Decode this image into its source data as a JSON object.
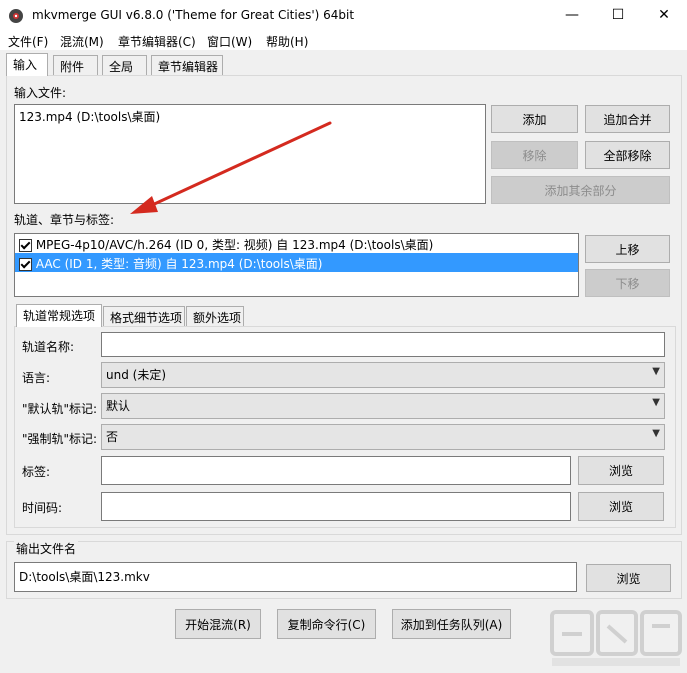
{
  "window": {
    "title": "mkvmerge GUI v6.8.0 ('Theme for Great Cities') 64bit",
    "controls": {
      "minimize": "—",
      "maximize": "☐",
      "close": "✕"
    }
  },
  "menu": [
    "文件(F)",
    "混流(M)",
    "章节编辑器(C)",
    "窗口(W)",
    "帮助(H)"
  ],
  "tabs": [
    "输入",
    "附件",
    "全局",
    "章节编辑器"
  ],
  "input": {
    "files_label": "输入文件:",
    "files": [
      "123.mp4 (D:\\tools\\桌面)"
    ],
    "buttons": {
      "add": "添加",
      "append": "追加合并",
      "remove": "移除",
      "remove_all": "全部移除",
      "add_other": "添加其余部分"
    },
    "tracks_label": "轨道、章节与标签:",
    "tracks": [
      {
        "text": "MPEG-4p10/AVC/h.264 (ID 0, 类型: 视频) 自 123.mp4 (D:\\tools\\桌面)",
        "checked": true,
        "selected": false
      },
      {
        "text": "AAC (ID 1, 类型: 音频) 自 123.mp4 (D:\\tools\\桌面)",
        "checked": true,
        "selected": true
      }
    ],
    "move_up": "上移",
    "move_down": "下移"
  },
  "subtabs": [
    "轨道常规选项",
    "格式细节选项",
    "额外选项"
  ],
  "options": {
    "track_name_label": "轨道名称:",
    "track_name_value": "",
    "language_label": "语言:",
    "language_value": "und (未定)",
    "default_flag_label": "\"默认轨\"标记:",
    "default_flag_value": "默认",
    "forced_flag_label": "\"强制轨\"标记:",
    "forced_flag_value": "否",
    "tags_label": "标签:",
    "tags_value": "",
    "timecodes_label": "时间码:",
    "timecodes_value": "",
    "browse": "浏览"
  },
  "output": {
    "label": "输出文件名",
    "value": "D:\\tools\\桌面\\123.mkv",
    "browse": "浏览"
  },
  "actions": {
    "start": "开始混流(R)",
    "copy_cmd": "复制命令行(C)",
    "add_job": "添加到任务队列(A)"
  },
  "annotation_color": "#d42a1f",
  "selection_color": "#3399ff",
  "watermark": "下载吧"
}
